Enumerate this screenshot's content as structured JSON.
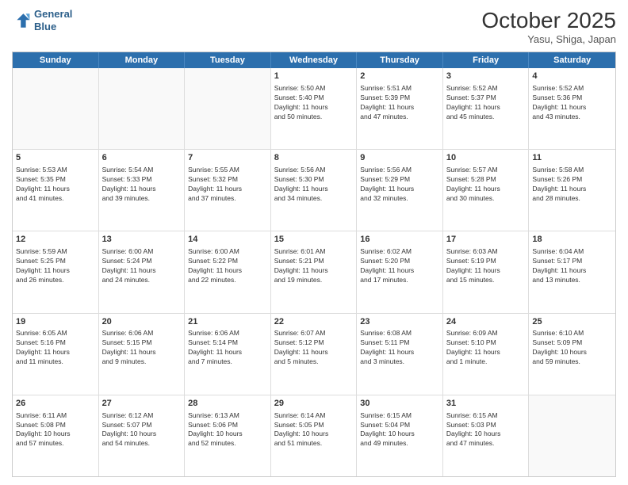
{
  "header": {
    "logo_line1": "General",
    "logo_line2": "Blue",
    "month_title": "October 2025",
    "subtitle": "Yasu, Shiga, Japan"
  },
  "day_headers": [
    "Sunday",
    "Monday",
    "Tuesday",
    "Wednesday",
    "Thursday",
    "Friday",
    "Saturday"
  ],
  "weeks": [
    [
      {
        "num": "",
        "info": ""
      },
      {
        "num": "",
        "info": ""
      },
      {
        "num": "",
        "info": ""
      },
      {
        "num": "1",
        "info": "Sunrise: 5:50 AM\nSunset: 5:40 PM\nDaylight: 11 hours\nand 50 minutes."
      },
      {
        "num": "2",
        "info": "Sunrise: 5:51 AM\nSunset: 5:39 PM\nDaylight: 11 hours\nand 47 minutes."
      },
      {
        "num": "3",
        "info": "Sunrise: 5:52 AM\nSunset: 5:37 PM\nDaylight: 11 hours\nand 45 minutes."
      },
      {
        "num": "4",
        "info": "Sunrise: 5:52 AM\nSunset: 5:36 PM\nDaylight: 11 hours\nand 43 minutes."
      }
    ],
    [
      {
        "num": "5",
        "info": "Sunrise: 5:53 AM\nSunset: 5:35 PM\nDaylight: 11 hours\nand 41 minutes."
      },
      {
        "num": "6",
        "info": "Sunrise: 5:54 AM\nSunset: 5:33 PM\nDaylight: 11 hours\nand 39 minutes."
      },
      {
        "num": "7",
        "info": "Sunrise: 5:55 AM\nSunset: 5:32 PM\nDaylight: 11 hours\nand 37 minutes."
      },
      {
        "num": "8",
        "info": "Sunrise: 5:56 AM\nSunset: 5:30 PM\nDaylight: 11 hours\nand 34 minutes."
      },
      {
        "num": "9",
        "info": "Sunrise: 5:56 AM\nSunset: 5:29 PM\nDaylight: 11 hours\nand 32 minutes."
      },
      {
        "num": "10",
        "info": "Sunrise: 5:57 AM\nSunset: 5:28 PM\nDaylight: 11 hours\nand 30 minutes."
      },
      {
        "num": "11",
        "info": "Sunrise: 5:58 AM\nSunset: 5:26 PM\nDaylight: 11 hours\nand 28 minutes."
      }
    ],
    [
      {
        "num": "12",
        "info": "Sunrise: 5:59 AM\nSunset: 5:25 PM\nDaylight: 11 hours\nand 26 minutes."
      },
      {
        "num": "13",
        "info": "Sunrise: 6:00 AM\nSunset: 5:24 PM\nDaylight: 11 hours\nand 24 minutes."
      },
      {
        "num": "14",
        "info": "Sunrise: 6:00 AM\nSunset: 5:22 PM\nDaylight: 11 hours\nand 22 minutes."
      },
      {
        "num": "15",
        "info": "Sunrise: 6:01 AM\nSunset: 5:21 PM\nDaylight: 11 hours\nand 19 minutes."
      },
      {
        "num": "16",
        "info": "Sunrise: 6:02 AM\nSunset: 5:20 PM\nDaylight: 11 hours\nand 17 minutes."
      },
      {
        "num": "17",
        "info": "Sunrise: 6:03 AM\nSunset: 5:19 PM\nDaylight: 11 hours\nand 15 minutes."
      },
      {
        "num": "18",
        "info": "Sunrise: 6:04 AM\nSunset: 5:17 PM\nDaylight: 11 hours\nand 13 minutes."
      }
    ],
    [
      {
        "num": "19",
        "info": "Sunrise: 6:05 AM\nSunset: 5:16 PM\nDaylight: 11 hours\nand 11 minutes."
      },
      {
        "num": "20",
        "info": "Sunrise: 6:06 AM\nSunset: 5:15 PM\nDaylight: 11 hours\nand 9 minutes."
      },
      {
        "num": "21",
        "info": "Sunrise: 6:06 AM\nSunset: 5:14 PM\nDaylight: 11 hours\nand 7 minutes."
      },
      {
        "num": "22",
        "info": "Sunrise: 6:07 AM\nSunset: 5:12 PM\nDaylight: 11 hours\nand 5 minutes."
      },
      {
        "num": "23",
        "info": "Sunrise: 6:08 AM\nSunset: 5:11 PM\nDaylight: 11 hours\nand 3 minutes."
      },
      {
        "num": "24",
        "info": "Sunrise: 6:09 AM\nSunset: 5:10 PM\nDaylight: 11 hours\nand 1 minute."
      },
      {
        "num": "25",
        "info": "Sunrise: 6:10 AM\nSunset: 5:09 PM\nDaylight: 10 hours\nand 59 minutes."
      }
    ],
    [
      {
        "num": "26",
        "info": "Sunrise: 6:11 AM\nSunset: 5:08 PM\nDaylight: 10 hours\nand 57 minutes."
      },
      {
        "num": "27",
        "info": "Sunrise: 6:12 AM\nSunset: 5:07 PM\nDaylight: 10 hours\nand 54 minutes."
      },
      {
        "num": "28",
        "info": "Sunrise: 6:13 AM\nSunset: 5:06 PM\nDaylight: 10 hours\nand 52 minutes."
      },
      {
        "num": "29",
        "info": "Sunrise: 6:14 AM\nSunset: 5:05 PM\nDaylight: 10 hours\nand 51 minutes."
      },
      {
        "num": "30",
        "info": "Sunrise: 6:15 AM\nSunset: 5:04 PM\nDaylight: 10 hours\nand 49 minutes."
      },
      {
        "num": "31",
        "info": "Sunrise: 6:15 AM\nSunset: 5:03 PM\nDaylight: 10 hours\nand 47 minutes."
      },
      {
        "num": "",
        "info": ""
      }
    ]
  ]
}
